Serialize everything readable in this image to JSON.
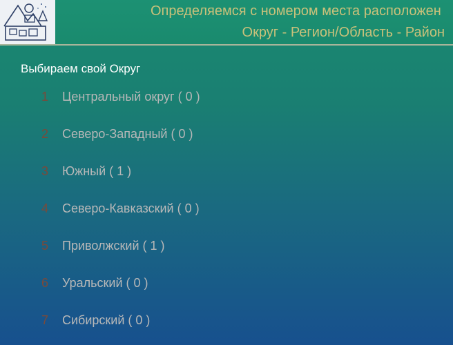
{
  "header": {
    "logo_icon": "house-map-logo-icon",
    "title_line1": "Определяемся с номером места расположен",
    "title_line2": "Округ - Регион/Область - Район"
  },
  "section": {
    "title": "Выбираем свой Округ"
  },
  "districts": [
    {
      "num": "1",
      "label": "Центральный округ ( 0 )"
    },
    {
      "num": "2",
      "label": "Северо-Западный ( 0 )"
    },
    {
      "num": "3",
      "label": "Южный ( 1 )"
    },
    {
      "num": "4",
      "label": "Северо-Кавказский ( 0 )"
    },
    {
      "num": "5",
      "label": "Приволжский ( 1 )"
    },
    {
      "num": "6",
      "label": "Уральский ( 0 )"
    },
    {
      "num": "7",
      "label": "Сибирский ( 0 )"
    }
  ],
  "colors": {
    "title": "#c9c17a",
    "number": "#7a4a3a",
    "label": "#b8b8b8",
    "section": "#ffffff"
  }
}
